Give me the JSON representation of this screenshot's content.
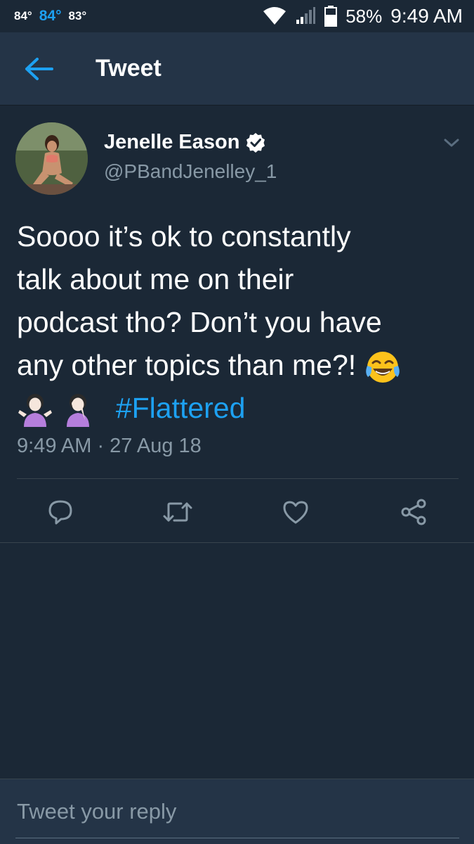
{
  "status_bar": {
    "temp_1": "84°",
    "temp_2": "84°",
    "temp_3": "83°",
    "battery_percent": "58%",
    "time": "9:49 AM"
  },
  "header": {
    "title": "Tweet",
    "back_icon": "arrow-left-icon"
  },
  "tweet": {
    "author_name": "Jenelle Eason",
    "verified": true,
    "handle": "@PBandJenelley_1",
    "text_lines": [
      "Soooo it’s ok to constantly",
      "talk about me on their",
      "podcast tho? Don’t you have",
      "any other topics than me?!"
    ],
    "hashtag": "#Flattered",
    "timestamp": "9:49 AM · 27 Aug 18",
    "emojis": [
      "face-with-tears-of-joy",
      "person-shrugging",
      "person-facepalming"
    ]
  },
  "actions": [
    {
      "name": "reply",
      "icon": "reply-icon"
    },
    {
      "name": "retweet",
      "icon": "retweet-icon"
    },
    {
      "name": "like",
      "icon": "heart-icon"
    },
    {
      "name": "share",
      "icon": "share-icon"
    }
  ],
  "reply": {
    "placeholder": "Tweet your reply"
  },
  "colors": {
    "background": "#1b2836",
    "header": "#243447",
    "accent": "#1da1f2",
    "secondary_text": "#8899a6"
  }
}
